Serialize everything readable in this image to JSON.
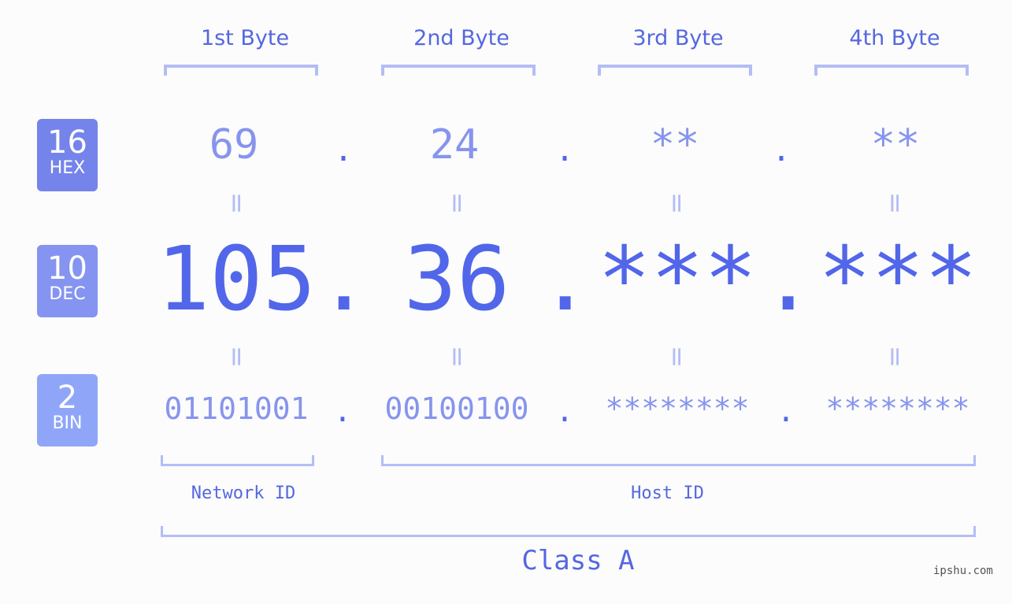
{
  "bytes": [
    {
      "label": "1st Byte",
      "hex": "69",
      "dec": "105",
      "bin": "01101001"
    },
    {
      "label": "2nd Byte",
      "hex": "24",
      "dec": "36",
      "bin": "00100100"
    },
    {
      "label": "3rd Byte",
      "hex": "**",
      "dec": "***",
      "bin": "********"
    },
    {
      "label": "4th Byte",
      "hex": "**",
      "dec": "***",
      "bin": "********"
    }
  ],
  "bases": {
    "hex": {
      "num": "16",
      "label": "HEX",
      "color": "#7584ea"
    },
    "dec": {
      "num": "10",
      "label": "DEC",
      "color": "#8594f0"
    },
    "bin": {
      "num": "2",
      "label": "BIN",
      "color": "#8fa6f8"
    }
  },
  "separator": ".",
  "equals": "=",
  "network_id_label": "Network ID",
  "host_id_label": "Host ID",
  "class_label": "Class A",
  "watermark": "ipshu.com"
}
